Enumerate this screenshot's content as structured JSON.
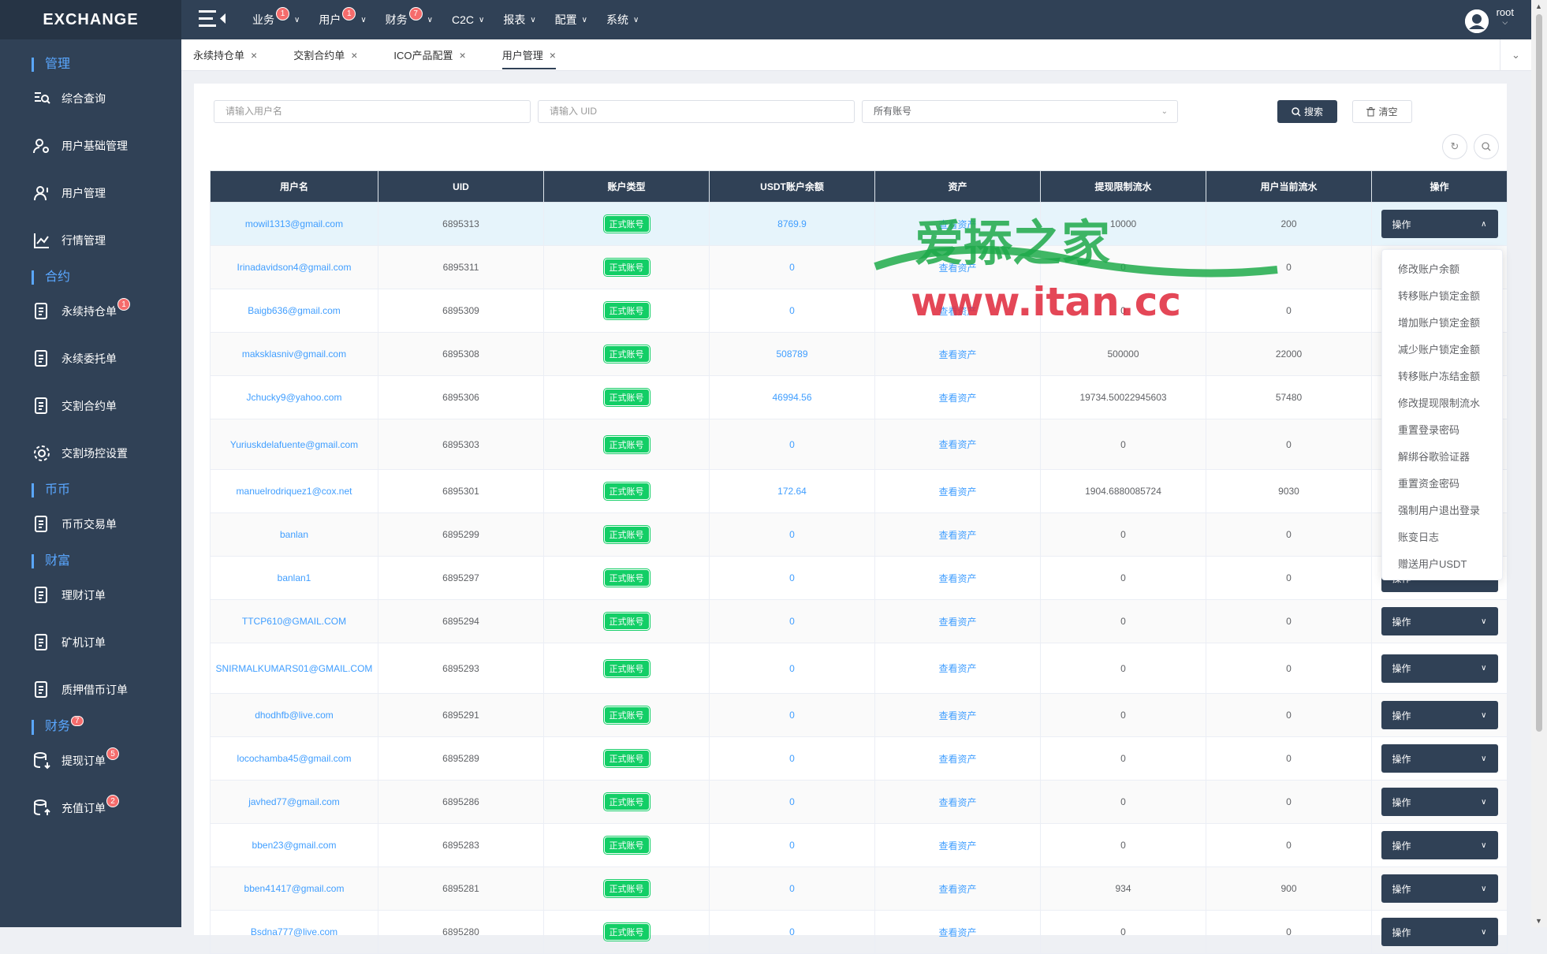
{
  "app": {
    "logo": "EXCHANGE"
  },
  "sidebar": {
    "sections": [
      {
        "label": "管理"
      },
      {
        "label": "合约"
      },
      {
        "label": "币币"
      },
      {
        "label": "财富"
      },
      {
        "label": "财务",
        "badge": "7"
      }
    ],
    "items": [
      {
        "label": "综合查询",
        "icon": "search-list-icon",
        "badge": ""
      },
      {
        "label": "用户基础管理",
        "icon": "user-gear-icon",
        "badge": ""
      },
      {
        "label": "用户管理",
        "icon": "user-icon",
        "badge": ""
      },
      {
        "label": "行情管理",
        "icon": "chart-line-icon",
        "badge": ""
      },
      {
        "label": "永续持仓单",
        "icon": "doc-chart-icon",
        "badge": "1"
      },
      {
        "label": "永续委托单",
        "icon": "doc-trend-icon",
        "badge": ""
      },
      {
        "label": "交割合约单",
        "icon": "doc-dollar-icon",
        "badge": ""
      },
      {
        "label": "交割场控设置",
        "icon": "gear-icon",
        "badge": ""
      },
      {
        "label": "币币交易单",
        "icon": "doc-exchange-icon",
        "badge": ""
      },
      {
        "label": "理财订单",
        "icon": "doc-money-icon",
        "badge": ""
      },
      {
        "label": "矿机订单",
        "icon": "doc-list-icon",
        "badge": ""
      },
      {
        "label": "质押借币订单",
        "icon": "doc-pledge-icon",
        "badge": ""
      },
      {
        "label": "提现订单",
        "icon": "database-out-icon",
        "badge": "5"
      },
      {
        "label": "充值订单",
        "icon": "database-in-icon",
        "badge": "2"
      }
    ]
  },
  "topnav": {
    "items": [
      {
        "label": "业务",
        "badge": "1"
      },
      {
        "label": "用户",
        "badge": "1"
      },
      {
        "label": "财务",
        "badge": "7"
      },
      {
        "label": "C2C",
        "badge": ""
      },
      {
        "label": "报表",
        "badge": ""
      },
      {
        "label": "配置",
        "badge": ""
      },
      {
        "label": "系统",
        "badge": ""
      }
    ],
    "user": "root"
  },
  "tabs": [
    {
      "label": "永续持仓单"
    },
    {
      "label": "交割合约单"
    },
    {
      "label": "ICO产品配置"
    },
    {
      "label": "用户管理"
    }
  ],
  "filters": {
    "username_placeholder": "请输入用户名",
    "uid_placeholder": "请输入 UID",
    "account_select": "所有账号",
    "search_label": "搜索",
    "clear_label": "清空"
  },
  "table": {
    "headers": [
      "用户名",
      "UID",
      "账户类型",
      "USDT账户余额",
      "资产",
      "提现限制流水",
      "用户当前流水",
      "操作"
    ],
    "account_tag": "正式账号",
    "asset_link": "查看资产",
    "op_label": "操作",
    "rows": [
      {
        "username": "mowil1313@gmail.com",
        "uid": "6895313",
        "balance": "8769.9",
        "limit": "10000",
        "flow": "200"
      },
      {
        "username": "Irinadavidson4@gmail.com",
        "uid": "6895311",
        "balance": "0",
        "limit": "0",
        "flow": "0"
      },
      {
        "username": "Baigb636@gmail.com",
        "uid": "6895309",
        "balance": "0",
        "limit": "0",
        "flow": "0"
      },
      {
        "username": "maksklasniv@gmail.com",
        "uid": "6895308",
        "balance": "508789",
        "limit": "500000",
        "flow": "22000"
      },
      {
        "username": "Jchucky9@yahoo.com",
        "uid": "6895306",
        "balance": "46994.56",
        "limit": "19734.50022945603",
        "flow": "57480"
      },
      {
        "username": "Yuriuskdelafuente@gmail.com",
        "uid": "6895303",
        "balance": "0",
        "limit": "0",
        "flow": "0"
      },
      {
        "username": "manuelrodriquez1@cox.net",
        "uid": "6895301",
        "balance": "172.64",
        "limit": "1904.6880085724",
        "flow": "9030"
      },
      {
        "username": "banlan",
        "uid": "6895299",
        "balance": "0",
        "limit": "0",
        "flow": "0"
      },
      {
        "username": "banlan1",
        "uid": "6895297",
        "balance": "0",
        "limit": "0",
        "flow": "0"
      },
      {
        "username": "TTCP610@GMAIL.COM",
        "uid": "6895294",
        "balance": "0",
        "limit": "0",
        "flow": "0"
      },
      {
        "username": "SNIRMALKUMARS01@GMAIL.COM",
        "uid": "6895293",
        "balance": "0",
        "limit": "0",
        "flow": "0"
      },
      {
        "username": "dhodhfb@live.com",
        "uid": "6895291",
        "balance": "0",
        "limit": "0",
        "flow": "0"
      },
      {
        "username": "locochamba45@gmail.com",
        "uid": "6895289",
        "balance": "0",
        "limit": "0",
        "flow": "0"
      },
      {
        "username": "javhed77@gmail.com",
        "uid": "6895286",
        "balance": "0",
        "limit": "0",
        "flow": "0"
      },
      {
        "username": "bben23@gmail.com",
        "uid": "6895283",
        "balance": "0",
        "limit": "0",
        "flow": "0"
      },
      {
        "username": "bben41417@gmail.com",
        "uid": "6895281",
        "balance": "0",
        "limit": "934",
        "flow": "900"
      },
      {
        "username": "Bsdna777@live.com",
        "uid": "6895280",
        "balance": "0",
        "limit": "0",
        "flow": "0"
      }
    ]
  },
  "dropdown": {
    "items": [
      "修改账户余额",
      "转移账户锁定金额",
      "增加账户锁定金额",
      "减少账户锁定金额",
      "转移账户冻结金额",
      "修改提现限制流水",
      "重置登录密码",
      "解绑谷歌验证器",
      "重置资金密码",
      "强制用户退出登录",
      "账变日志",
      "赠送用户USDT"
    ]
  },
  "watermark": {
    "line1": "爱掭之家",
    "line2": "www.itan.cc"
  },
  "colors": {
    "sidebar": "#304156",
    "accent": "#409eff",
    "tag": "#13ce66",
    "badge": "#f56c6c"
  }
}
